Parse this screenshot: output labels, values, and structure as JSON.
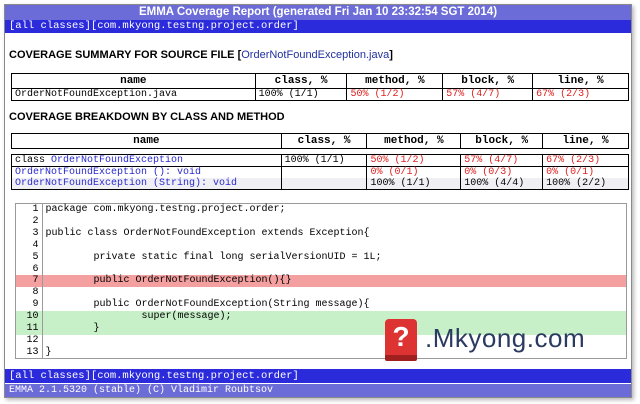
{
  "header": {
    "title": "EMMA Coverage Report (generated Fri Jan 10 23:32:54 SGT 2014)"
  },
  "nav": {
    "all_classes": "[all classes]",
    "package": "[com.mkyong.testng.project.order]"
  },
  "summary": {
    "heading": "COVERAGE SUMMARY FOR SOURCE FILE [",
    "file": "OrderNotFoundException.java",
    "heading_end": "]",
    "columns": [
      "name",
      "class, %",
      "method, %",
      "block, %",
      "line, %"
    ],
    "row": {
      "name": "OrderNotFoundException.java",
      "class": "100%  (1/1)",
      "method": "50%  (1/2)",
      "block": "57%  (4/7)",
      "line": "67%  (2/3)"
    }
  },
  "breakdown": {
    "heading": "COVERAGE BREAKDOWN BY CLASS AND METHOD",
    "columns": [
      "name",
      "class, %",
      "method, %",
      "block, %",
      "line, %"
    ],
    "rows": [
      {
        "prefix": "class ",
        "name": "OrderNotFoundException",
        "class": "100% (1/1)",
        "method": "50%  (1/2)",
        "block": "57%  (4/7)",
        "line": "67%  (2/3)"
      },
      {
        "prefix": "",
        "name": "OrderNotFoundException (): void",
        "class": "",
        "method": "0%   (0/1)",
        "block": "0%   (0/3)",
        "line": "0%   (0/1)"
      },
      {
        "prefix": "",
        "name": "OrderNotFoundException (String): void",
        "class": "",
        "method": "100% (1/1)",
        "block": "100% (4/4)",
        "line": "100% (2/2)"
      }
    ]
  },
  "source": {
    "lines": [
      {
        "n": "1",
        "text": "package com.mkyong.testng.project.order;",
        "status": ""
      },
      {
        "n": "2",
        "text": "",
        "status": ""
      },
      {
        "n": "3",
        "text": "public class OrderNotFoundException extends Exception{",
        "status": ""
      },
      {
        "n": "4",
        "text": "",
        "status": ""
      },
      {
        "n": "5",
        "text": "        private static final long serialVersionUID = 1L;",
        "status": ""
      },
      {
        "n": "6",
        "text": "",
        "status": ""
      },
      {
        "n": "7",
        "text": "        public OrderNotFoundException(){}",
        "status": "missed"
      },
      {
        "n": "8",
        "text": "",
        "status": ""
      },
      {
        "n": "9",
        "text": "        public OrderNotFoundException(String message){",
        "status": ""
      },
      {
        "n": "10",
        "text": "                super(message);",
        "status": "covered"
      },
      {
        "n": "11",
        "text": "        }",
        "status": "covered"
      },
      {
        "n": "12",
        "text": "",
        "status": ""
      },
      {
        "n": "13",
        "text": "}",
        "status": ""
      }
    ]
  },
  "watermark": {
    "symbol": "?",
    "text": ".Mkyong.com"
  },
  "footer": {
    "version": "EMMA 2.1.5320 (stable) (C) Vladimir Roubtsov"
  },
  "colors": {
    "title_bar": "#6c6cd8",
    "nav_bar": "#2b2bdc",
    "missed": "#f4a0a0",
    "covered": "#c8f0c8",
    "low_coverage": "#e02020"
  }
}
